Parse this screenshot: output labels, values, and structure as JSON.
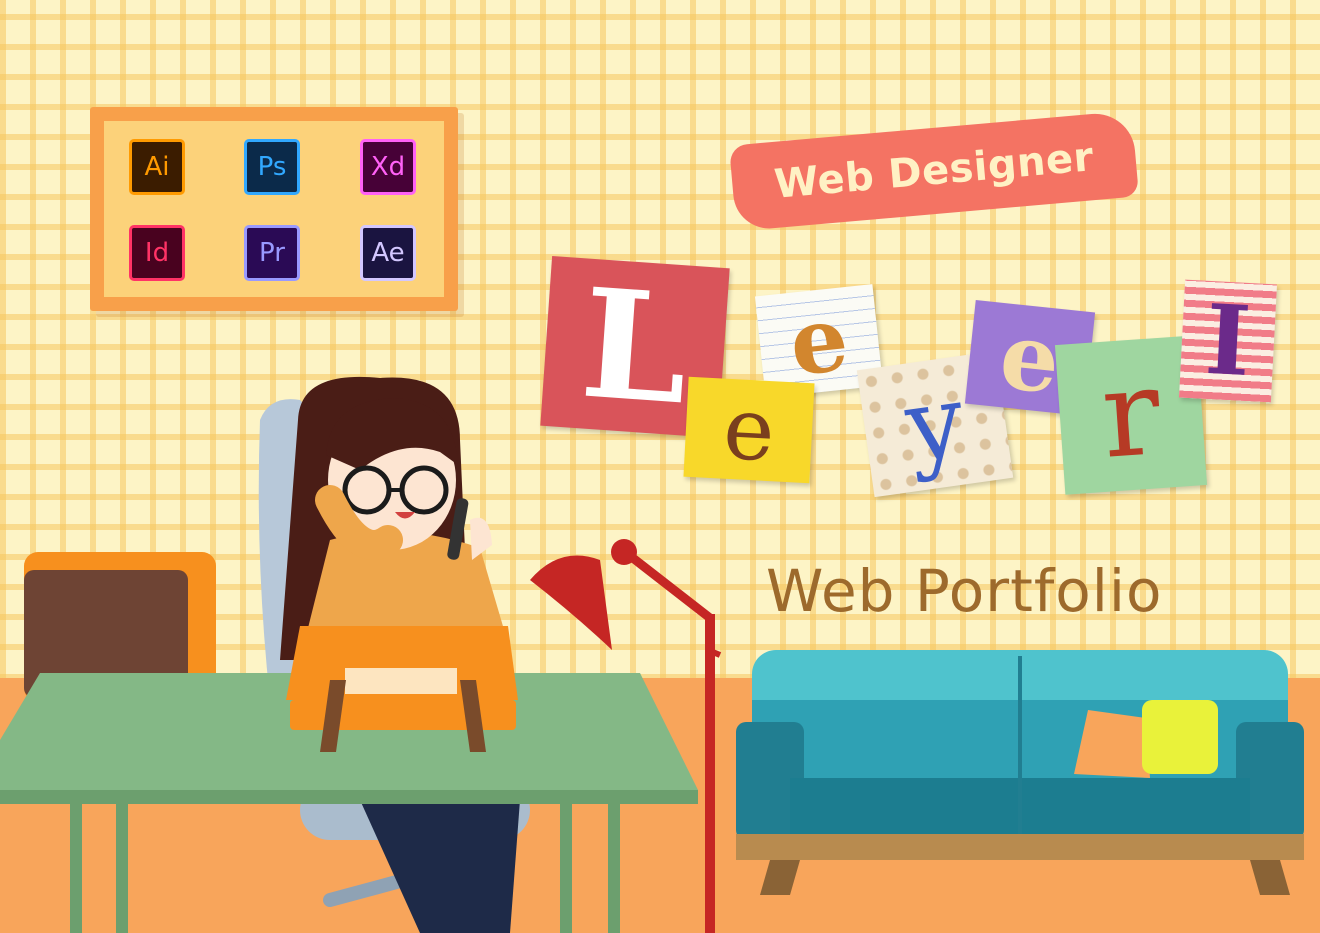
{
  "apps": [
    {
      "label": "Ai",
      "name": "illustrator",
      "bg": "#3b1c00",
      "fg": "#ff9a00"
    },
    {
      "label": "Ps",
      "name": "photoshop",
      "bg": "#0b2a4a",
      "fg": "#31a8ff"
    },
    {
      "label": "Xd",
      "name": "xd",
      "bg": "#470137",
      "fg": "#ff61f6"
    },
    {
      "label": "Id",
      "name": "indesign",
      "bg": "#49021f",
      "fg": "#ff3366"
    },
    {
      "label": "Pr",
      "name": "premiere",
      "bg": "#2a0a55",
      "fg": "#9999ff"
    },
    {
      "label": "Ae",
      "name": "aftereffects",
      "bg": "#1a1440",
      "fg": "#d3c7ff"
    }
  ],
  "tagline": "Web Designer",
  "logo_letters": [
    "L",
    "e",
    "e",
    "y",
    "e",
    "r",
    "I"
  ],
  "subtitle": "Web Portfolio",
  "colors": {
    "wall": "#fdf4c6",
    "grid": "#f6c65f",
    "floor": "#f8a55b",
    "tag": "#f47363",
    "desk": "#84b886",
    "sofa": "#2fa1b4",
    "lamp": "#c52624"
  }
}
